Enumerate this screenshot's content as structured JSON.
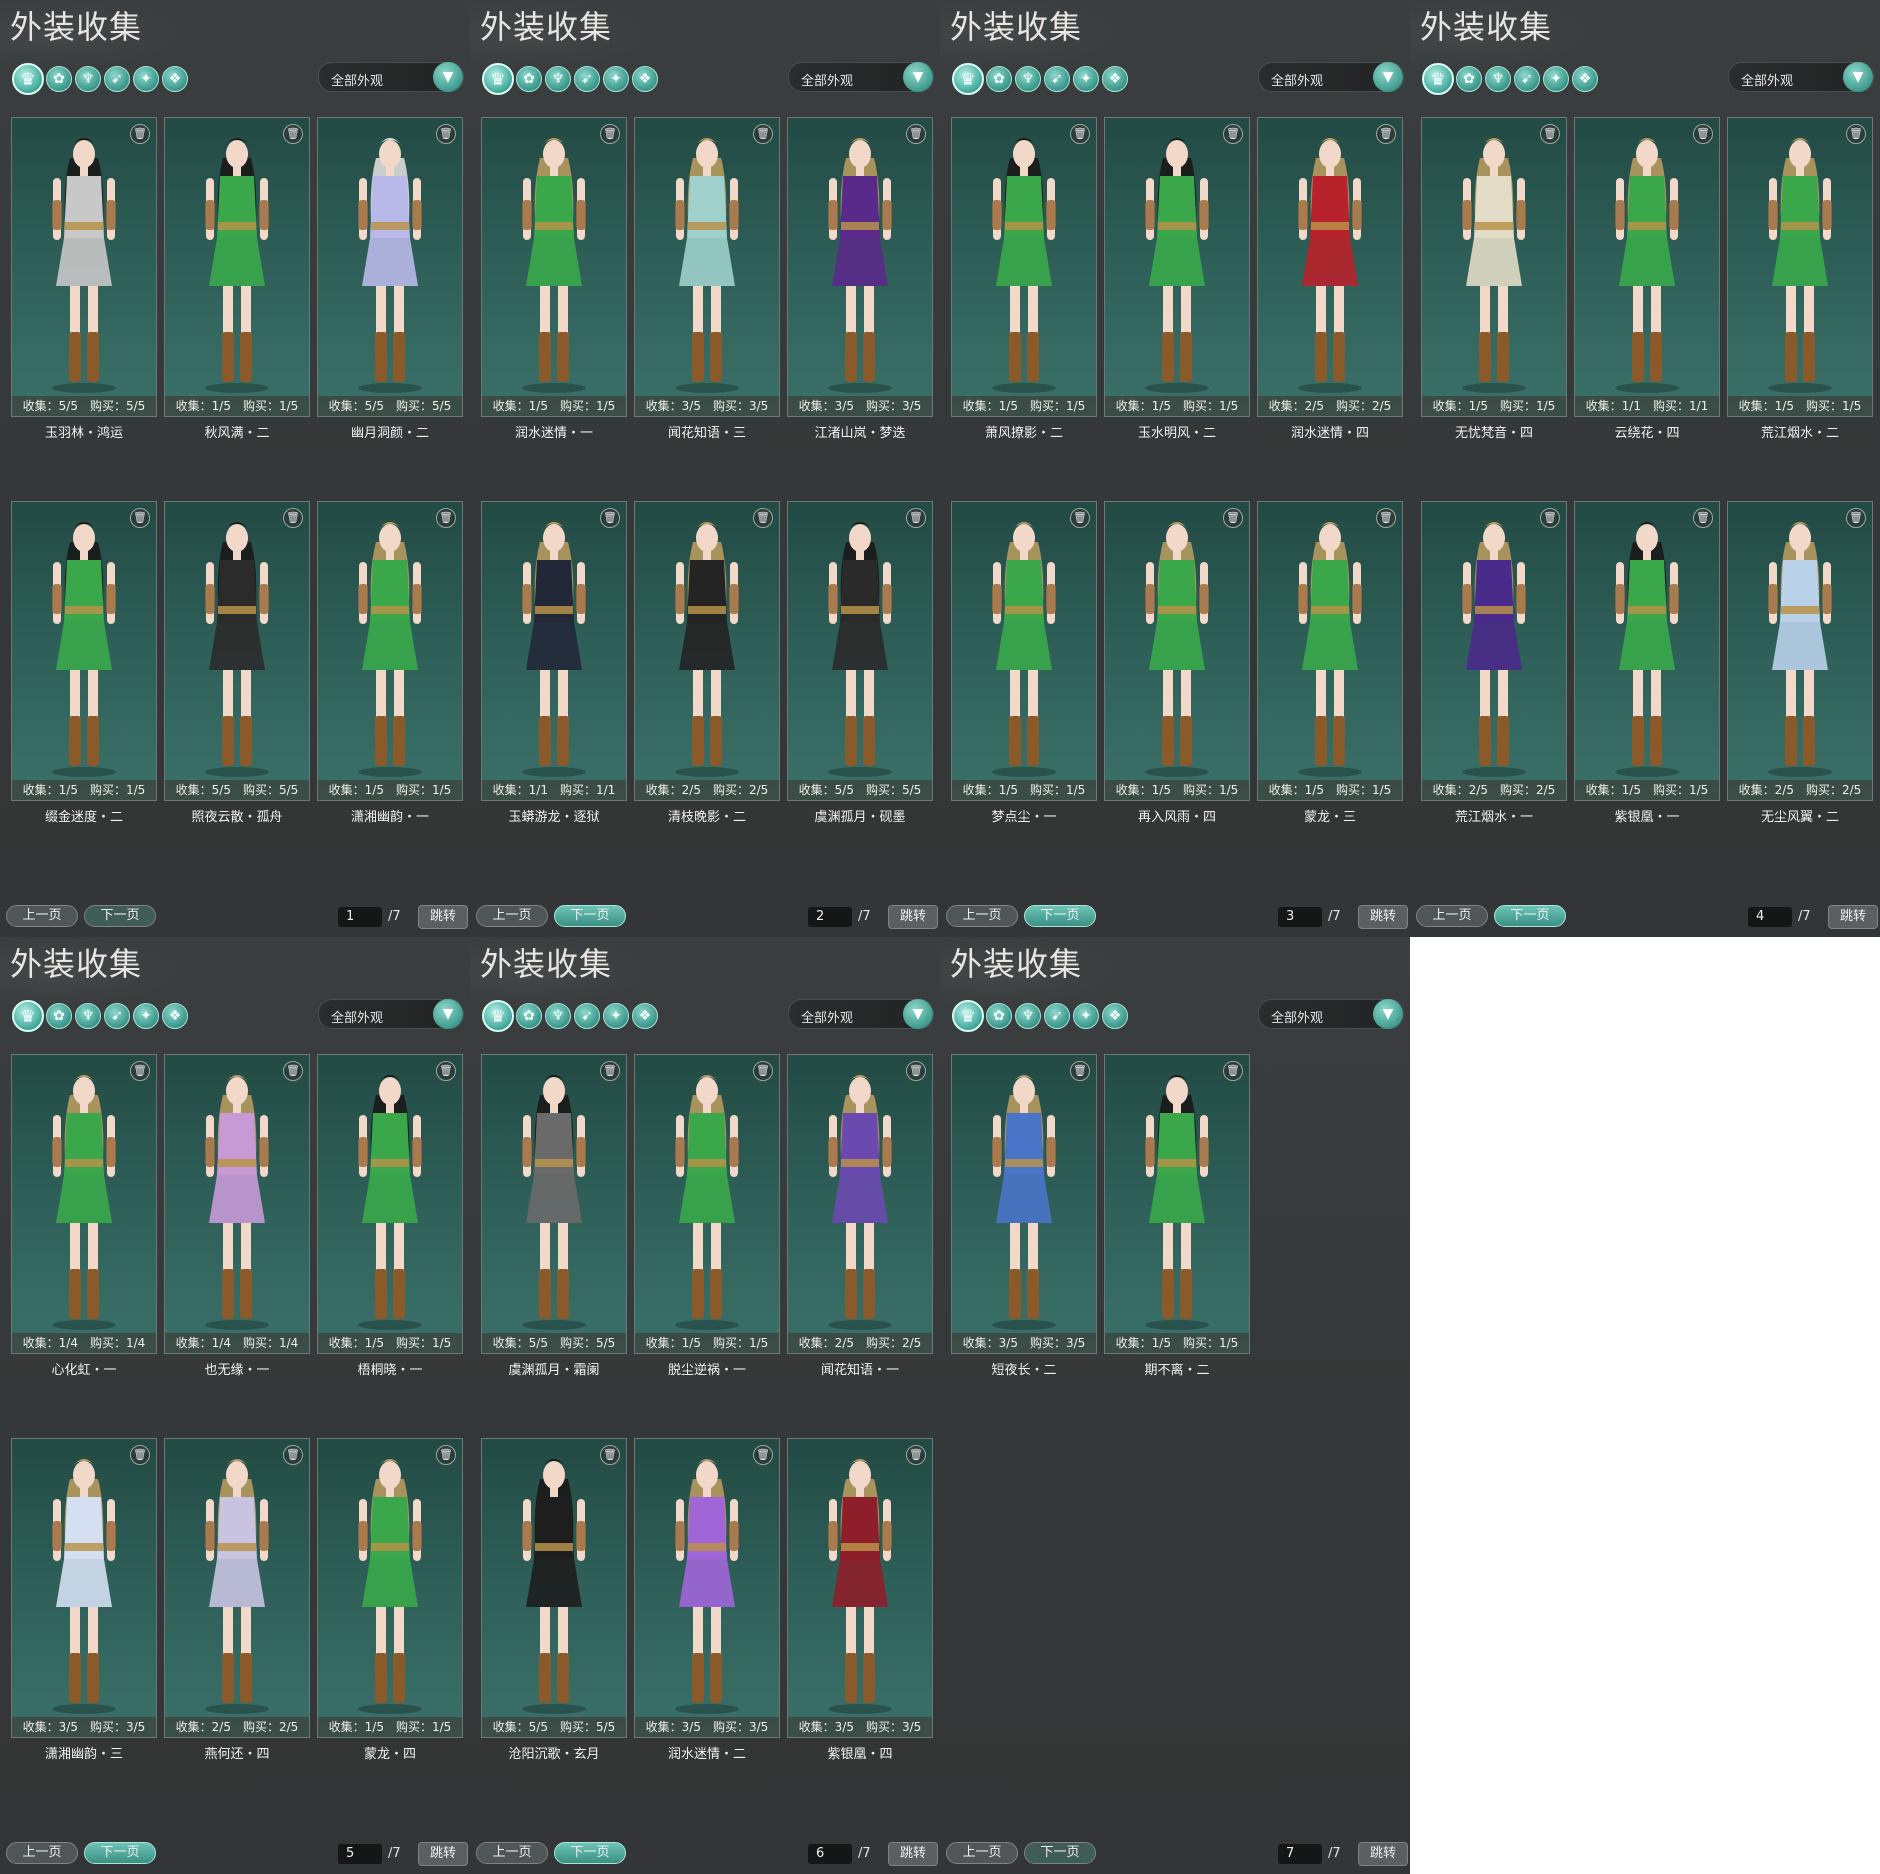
{
  "title": "外装收集",
  "filter": {
    "label": "全部外观",
    "arrow_icon": "chevron-down-icon"
  },
  "category_icons": [
    "all-outfits-icon",
    "top-icon",
    "body-icon",
    "shoes-icon",
    "accessory-icon",
    "pants-icon"
  ],
  "pager": {
    "prev": "上一页",
    "next": "下一页",
    "jump": "跳转",
    "total": "/7"
  },
  "colors": {
    "accent": "#4fb3a5",
    "panel_bg": "#383b3c",
    "card_bg": "#2c5c55"
  },
  "pages": [
    {
      "page": "1",
      "next_active": false,
      "items": [
        {
          "name": "玉羽林・鸿运",
          "stat": "收集：5/5　购买：5/5",
          "outfit": "#c8c8c8",
          "hair": "#1a1a1a"
        },
        {
          "name": "秋风满・二",
          "stat": "收集：1/5　购买：1/5",
          "outfit": "#3aa84a",
          "hair": "#1a1a1a"
        },
        {
          "name": "幽月洞颜・二",
          "stat": "收集：5/5　购买：5/5",
          "outfit": "#b8b9e8",
          "hair": "#dcdcdc"
        },
        {
          "name": "缀金迷度・二",
          "stat": "收集：1/5　购买：1/5",
          "outfit": "#3aa84a",
          "hair": "#1a1a1a"
        },
        {
          "name": "照夜云散・孤舟",
          "stat": "收集：5/5　购买：5/5",
          "outfit": "#2b2b2b",
          "hair": "#1a1a1a"
        },
        {
          "name": "潇湘幽韵・一",
          "stat": "收集：1/5　购买：1/5",
          "outfit": "#3aa84a",
          "hair": "#b79a5f"
        }
      ]
    },
    {
      "page": "2",
      "next_active": true,
      "items": [
        {
          "name": "润水迷情・一",
          "stat": "收集：1/5　购买：1/5",
          "outfit": "#3aa84a",
          "hair": "#b79a5f"
        },
        {
          "name": "闻花知语・三",
          "stat": "收集：3/5　购买：3/5",
          "outfit": "#9fd0cc",
          "hair": "#b79a5f"
        },
        {
          "name": "江渚山岚・梦迭",
          "stat": "收集：3/5　购买：3/5",
          "outfit": "#5a2a8a",
          "hair": "#b79a5f"
        },
        {
          "name": "玉蟒游龙・逐狱",
          "stat": "收集：1/1　购买：1/1",
          "outfit": "#232838",
          "hair": "#b79a5f"
        },
        {
          "name": "清枝晚影・二",
          "stat": "收集：2/5　购买：2/5",
          "outfit": "#242424",
          "hair": "#b79a5f"
        },
        {
          "name": "虞渊孤月・砚墨",
          "stat": "收集：5/5　购买：5/5",
          "outfit": "#2a2a2a",
          "hair": "#1a1a1a"
        }
      ]
    },
    {
      "page": "3",
      "next_active": true,
      "items": [
        {
          "name": "萧风撩影・二",
          "stat": "收集：1/5　购买：1/5",
          "outfit": "#3aa84a",
          "hair": "#1a1a1a"
        },
        {
          "name": "玉水明风・二",
          "stat": "收集：1/5　购买：1/5",
          "outfit": "#3aa84a",
          "hair": "#1a1a1a"
        },
        {
          "name": "润水迷情・四",
          "stat": "收集：2/5　购买：2/5",
          "outfit": "#b8222a",
          "hair": "#b79a5f"
        },
        {
          "name": "梦点尘・一",
          "stat": "收集：1/5　购买：1/5",
          "outfit": "#3aa84a",
          "hair": "#b79a5f"
        },
        {
          "name": "再入风雨・四",
          "stat": "收集：1/5　购买：1/5",
          "outfit": "#3aa84a",
          "hair": "#b79a5f"
        },
        {
          "name": "蒙龙・三",
          "stat": "收集：1/5　购买：1/5",
          "outfit": "#3aa84a",
          "hair": "#b79a5f"
        }
      ]
    },
    {
      "page": "4",
      "next_active": true,
      "items": [
        {
          "name": "无忧梵音・四",
          "stat": "收集：1/5　购买：1/5",
          "outfit": "#e2dcc6",
          "hair": "#b79a5f"
        },
        {
          "name": "云绕花・四",
          "stat": "收集：1/1　购买：1/1",
          "outfit": "#3aa84a",
          "hair": "#b79a5f"
        },
        {
          "name": "荒江烟水・二",
          "stat": "收集：1/5　购买：1/5",
          "outfit": "#3aa84a",
          "hair": "#b79a5f"
        },
        {
          "name": "荒江烟水・一",
          "stat": "收集：2/5　购买：2/5",
          "outfit": "#4a2a8a",
          "hair": "#b79a5f"
        },
        {
          "name": "紫银凰・一",
          "stat": "收集：1/5　购买：1/5",
          "outfit": "#3aa84a",
          "hair": "#1a1a1a"
        },
        {
          "name": "无尘风翼・二",
          "stat": "收集：2/5　购买：2/5",
          "outfit": "#b9d2ea",
          "hair": "#b79a5f"
        }
      ]
    },
    {
      "page": "5",
      "next_active": true,
      "items": [
        {
          "name": "心化虹・一",
          "stat": "收集：1/4　购买：1/4",
          "outfit": "#3aa84a",
          "hair": "#b79a5f"
        },
        {
          "name": "也无缘・一",
          "stat": "收集：1/4　购买：1/4",
          "outfit": "#c79ad6",
          "hair": "#b79a5f"
        },
        {
          "name": "梧桐晓・一",
          "stat": "收集：1/5　购买：1/5",
          "outfit": "#3aa84a",
          "hair": "#1a1a1a"
        },
        {
          "name": "潇湘幽韵・三",
          "stat": "收集：3/5　购买：3/5",
          "outfit": "#d4e0f2",
          "hair": "#b79a5f"
        },
        {
          "name": "燕何还・四",
          "stat": "收集：2/5　购买：2/5",
          "outfit": "#c8c3e0",
          "hair": "#b79a5f"
        },
        {
          "name": "蒙龙・四",
          "stat": "收集：1/5　购买：1/5",
          "outfit": "#3aa84a",
          "hair": "#b79a5f"
        }
      ]
    },
    {
      "page": "6",
      "next_active": true,
      "items": [
        {
          "name": "虞渊孤月・霜阑",
          "stat": "收集：5/5　购买：5/5",
          "outfit": "#6a6a6a",
          "hair": "#1a1a1a"
        },
        {
          "name": "脱尘逆祸・一",
          "stat": "收集：1/5　购买：1/5",
          "outfit": "#3aa84a",
          "hair": "#b79a5f"
        },
        {
          "name": "闻花知语・一",
          "stat": "收集：2/5　购买：2/5",
          "outfit": "#6b4ab0",
          "hair": "#b79a5f"
        },
        {
          "name": "沧阳沉歌・玄月",
          "stat": "收集：5/5　购买：5/5",
          "outfit": "#1e1e1e",
          "hair": "#1a1a1a"
        },
        {
          "name": "润水迷情・二",
          "stat": "收集：3/5　购买：3/5",
          "outfit": "#a066d8",
          "hair": "#b79a5f"
        },
        {
          "name": "紫银凰・四",
          "stat": "收集：3/5　购买：3/5",
          "outfit": "#8e1e2a",
          "hair": "#b79a5f"
        }
      ]
    },
    {
      "page": "7",
      "next_active": false,
      "items": [
        {
          "name": "短夜长・二",
          "stat": "收集：3/5　购买：3/5",
          "outfit": "#4a74c8",
          "hair": "#b79a5f"
        },
        {
          "name": "期不离・二",
          "stat": "收集：1/5　购买：1/5",
          "outfit": "#3aa84a",
          "hair": "#1a1a1a"
        }
      ]
    }
  ]
}
